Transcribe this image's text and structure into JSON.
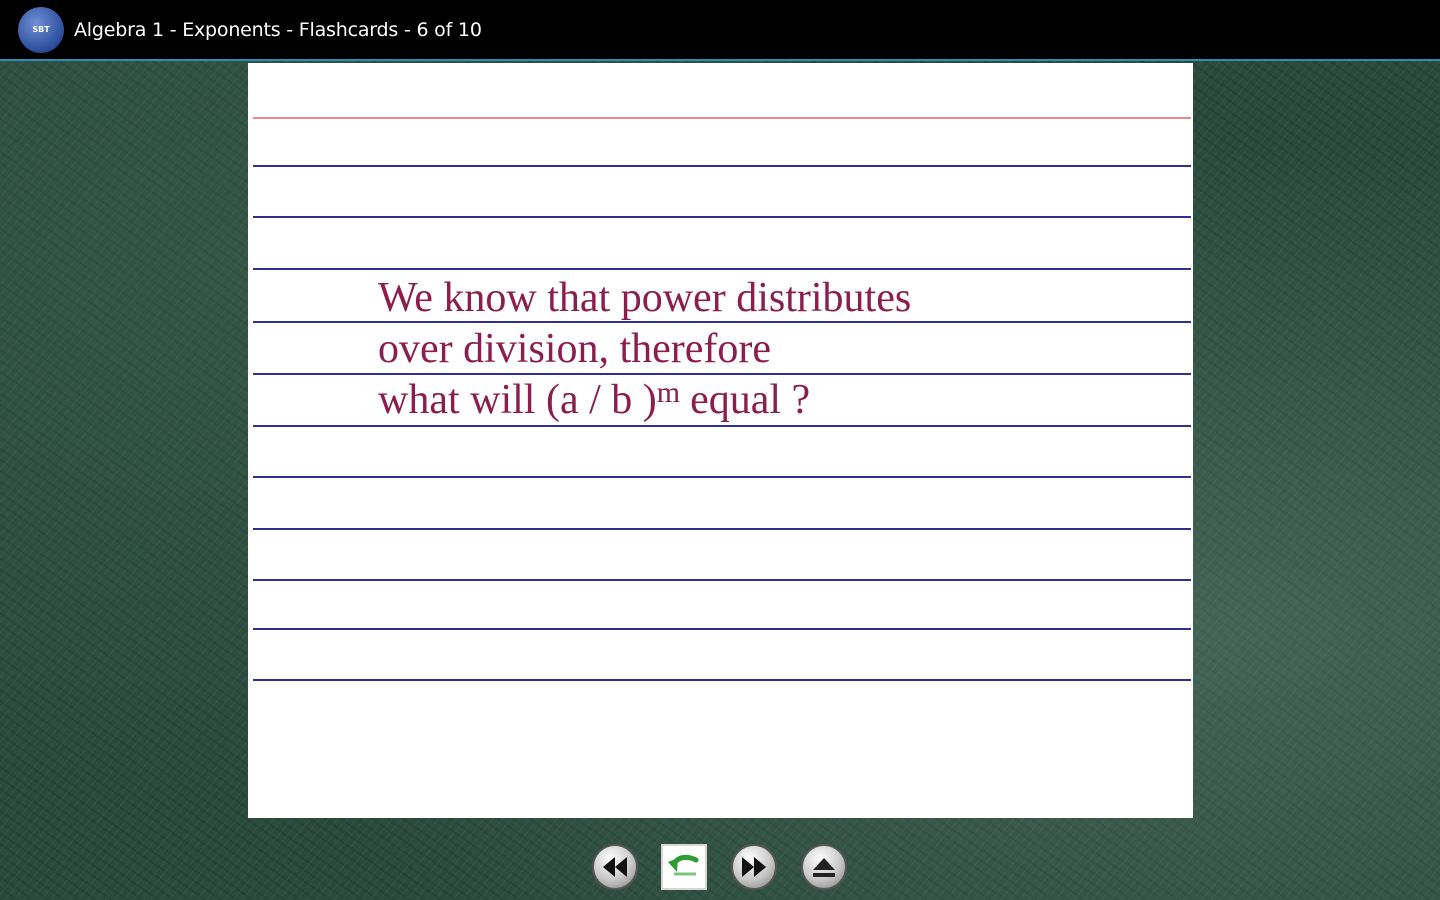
{
  "window": {
    "title": "Algebra 1 - Exponents - Flashcards - 6 of 10",
    "icon": "app-logo-icon",
    "icon_text": "SBT"
  },
  "card": {
    "line1": "We know that power distributes",
    "line2": "over division, therefore",
    "line3_before": "what will (a / b )",
    "line3_sup": "m",
    "line3_after": "equal ?"
  },
  "controls": {
    "previous": "rewind-icon",
    "flip": "flip-card-icon",
    "next": "fast-forward-icon",
    "eject": "eject-icon"
  },
  "colors": {
    "title_bar": "#000000",
    "accent": "#2b8fb3",
    "card_text": "#8b1e4e",
    "rule_blue": "#2f2f8f",
    "rule_red": "#f08a8a"
  }
}
